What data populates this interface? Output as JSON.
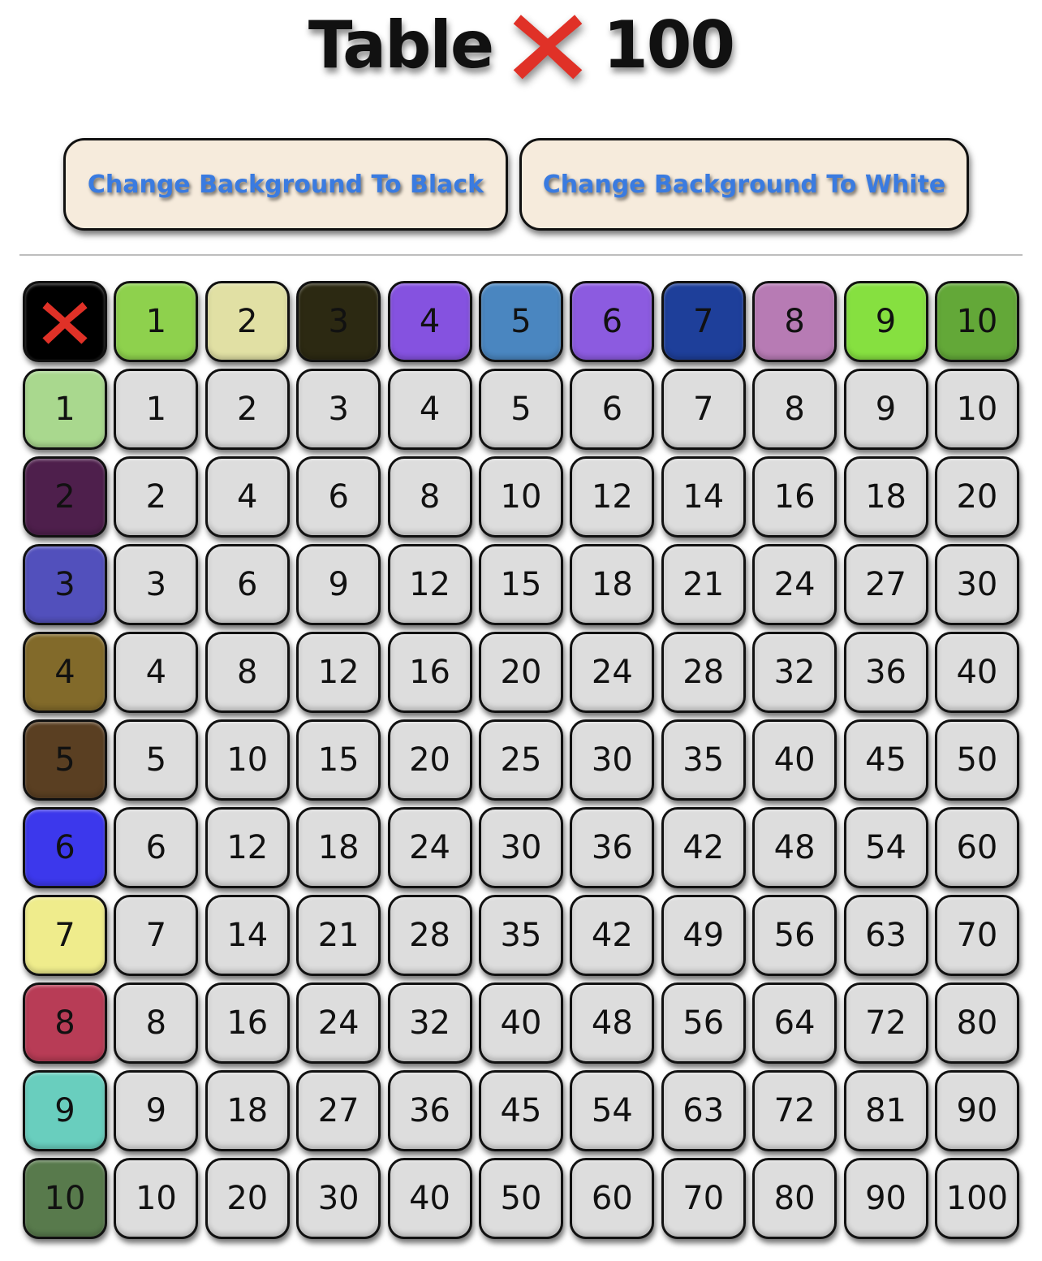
{
  "header": {
    "title_left": "Table",
    "title_icon": "cross-mark-icon",
    "title_right": "100"
  },
  "buttons": {
    "black_label": "Change Background To Black",
    "white_label": "Change Background To White"
  },
  "table": {
    "corner_icon": "cross-mark-icon",
    "column_headers": [
      "1",
      "2",
      "3",
      "4",
      "5",
      "6",
      "7",
      "8",
      "9",
      "10"
    ],
    "column_header_colors": [
      "#8ed14d",
      "#e1e0a4",
      "#2c2912",
      "#8552e0",
      "#4a86c0",
      "#8c5be0",
      "#1e3f9a",
      "#b77bb4",
      "#86e040",
      "#63a838"
    ],
    "row_headers": [
      "1",
      "2",
      "3",
      "4",
      "5",
      "6",
      "7",
      "8",
      "9",
      "10"
    ],
    "row_header_colors": [
      "#a9d88e",
      "#4e1f4c",
      "#5250bc",
      "#826a2a",
      "#5a3f22",
      "#3c38ec",
      "#efec8c",
      "#b83c56",
      "#69cebe",
      "#587a4c"
    ],
    "rows": [
      [
        "1",
        "2",
        "3",
        "4",
        "5",
        "6",
        "7",
        "8",
        "9",
        "10"
      ],
      [
        "2",
        "4",
        "6",
        "8",
        "10",
        "12",
        "14",
        "16",
        "18",
        "20"
      ],
      [
        "3",
        "6",
        "9",
        "12",
        "15",
        "18",
        "21",
        "24",
        "27",
        "30"
      ],
      [
        "4",
        "8",
        "12",
        "16",
        "20",
        "24",
        "28",
        "32",
        "36",
        "40"
      ],
      [
        "5",
        "10",
        "15",
        "20",
        "25",
        "30",
        "35",
        "40",
        "45",
        "50"
      ],
      [
        "6",
        "12",
        "18",
        "24",
        "30",
        "36",
        "42",
        "48",
        "54",
        "60"
      ],
      [
        "7",
        "14",
        "21",
        "28",
        "35",
        "42",
        "49",
        "56",
        "63",
        "70"
      ],
      [
        "8",
        "16",
        "24",
        "32",
        "40",
        "48",
        "56",
        "64",
        "72",
        "80"
      ],
      [
        "9",
        "18",
        "27",
        "36",
        "45",
        "54",
        "63",
        "72",
        "81",
        "90"
      ],
      [
        "10",
        "20",
        "30",
        "40",
        "50",
        "60",
        "70",
        "80",
        "90",
        "100"
      ]
    ]
  },
  "colors": {
    "cell_background": "#dddddd",
    "button_background": "#f6ebdc",
    "button_text": "#3a7be0",
    "cross_red": "#e03127"
  }
}
